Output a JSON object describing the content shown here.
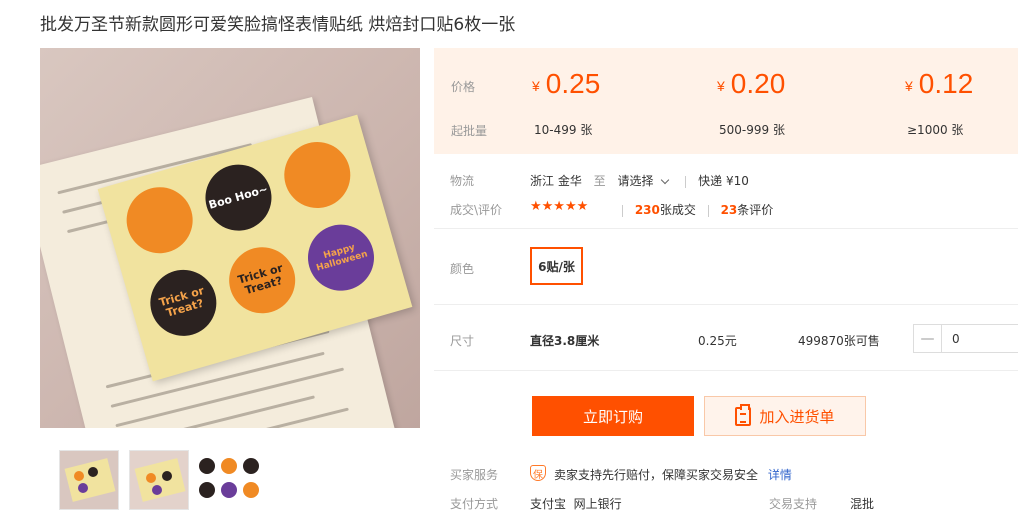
{
  "product": {
    "title": "批发万圣节新款圆形可爱笑脸搞怪表情贴纸 烘焙封口贴6枚一张"
  },
  "gallery": {
    "stickers": [
      {
        "text": "",
        "color": "#f08a24"
      },
      {
        "text": "Boo Hoo~",
        "color": "#2b2220"
      },
      {
        "text": "",
        "color": "#f08a24"
      },
      {
        "text": "Trick or Treat?",
        "color": "#2b2220"
      },
      {
        "text": "Trick or Treat?",
        "color": "#f08a24"
      },
      {
        "text": "Happy Halloween",
        "color": "#6a3d9a"
      }
    ],
    "thumb_count": 3
  },
  "pricing": {
    "price_label": "价格",
    "batch_label": "起批量",
    "currency": "¥",
    "tiers": [
      {
        "price": "0.25",
        "quantity": "10-499 张"
      },
      {
        "price": "0.20",
        "quantity": "500-999 张"
      },
      {
        "price": "0.12",
        "quantity": "≥1000 张"
      }
    ]
  },
  "logistics": {
    "label": "物流",
    "origin": "浙江 金华",
    "to": "至",
    "select": "请选择",
    "shipping": "快递 ¥10"
  },
  "reviews": {
    "label": "成交\\评价",
    "stars": "★★★★★",
    "sold_count": "230",
    "sold_suffix": "张成交",
    "review_count": "23",
    "review_suffix": "条评价"
  },
  "color": {
    "label": "颜色",
    "option": "6贴/张"
  },
  "size": {
    "label": "尺寸",
    "spec": "直径3.8厘米",
    "unit_price": "0.25元",
    "stock": "499870张可售",
    "quantity": "0",
    "minus": "—"
  },
  "actions": {
    "buy": "立即订购",
    "cart": "加入进货单"
  },
  "service": {
    "label": "买家服务",
    "badge": "保",
    "text": "卖家支持先行赔付，保障买家交易安全",
    "details": "详情"
  },
  "payment": {
    "label": "支付方式",
    "methods": "支付宝  网上银行",
    "trade_label": "交易支持",
    "trade_value": "混批"
  },
  "colors": {
    "accent": "#ff5000",
    "price_bg": "#fff2e8",
    "link": "#3366cc"
  }
}
